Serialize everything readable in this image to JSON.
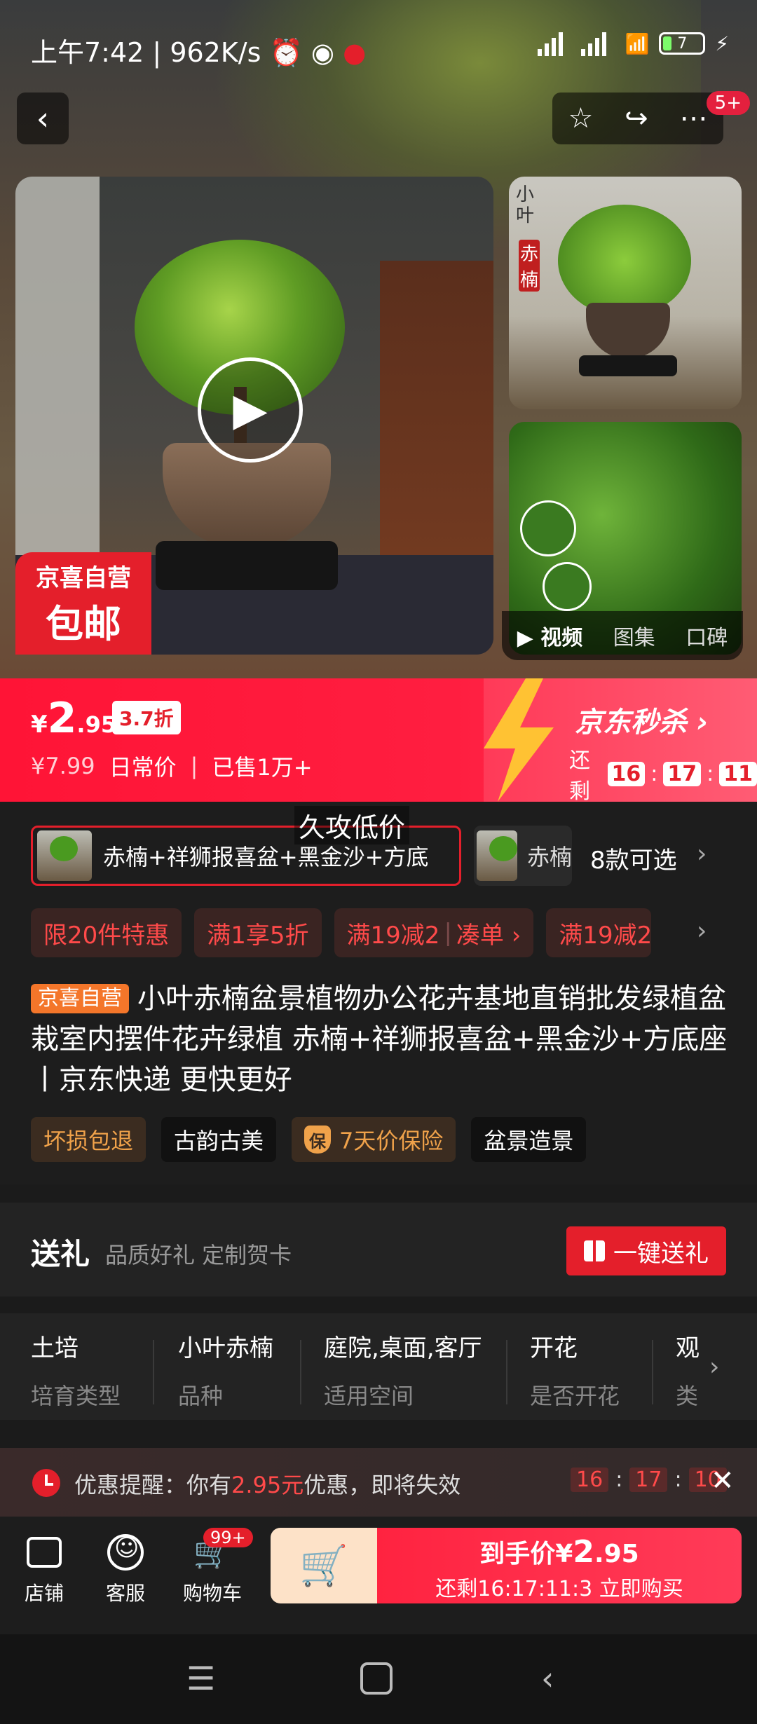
{
  "status_bar": {
    "time": "上午7:42",
    "speed": "962K/s",
    "battery": "7"
  },
  "header": {
    "notif_count": "5+"
  },
  "gallery": {
    "badge_line1": "京喜自营",
    "badge_line2": "包邮",
    "thumb_text_1": "小叶",
    "thumb_text_2": "赤楠",
    "tabs": [
      "视频",
      "图集",
      "口碑"
    ]
  },
  "price": {
    "currency": "¥",
    "int": "2",
    "dec": ".95",
    "discount": "3.7折",
    "orig": "¥7.99",
    "orig_label": "日常价",
    "sold": "已售1万+",
    "seckill_title": "京东秒杀",
    "seckill_remain": "还剩",
    "countdown": [
      "16",
      "17",
      "11"
    ]
  },
  "variants": {
    "low_price_tip": "久攻低价",
    "selected": "赤楠+祥狮报喜盆+黑金沙+方底",
    "second": "赤楠",
    "count": "8款可选"
  },
  "promos": [
    "限20件特惠",
    "满1享5折",
    "满19减2",
    "凑单 ›",
    "满19减2"
  ],
  "product": {
    "tag": "京喜自营",
    "title": "小叶赤楠盆景植物办公花卉基地直销批发绿植盆栽室内摆件花卉绿植 赤楠+祥狮报喜盆+黑金沙+方底座丨京东快递 更快更好"
  },
  "chips": {
    "c1": "坏损包退",
    "c2": "古韵古美",
    "c3_icon": "保",
    "c3": "7天价保险",
    "c4": "盆景造景"
  },
  "gift": {
    "title": "送礼",
    "sub": "品质好礼 定制贺卡",
    "button": "一键送礼"
  },
  "attributes": [
    {
      "value": "土培",
      "key": "培育类型"
    },
    {
      "value": "小叶赤楠",
      "key": "品种"
    },
    {
      "value": "庭院,桌面,客厅",
      "key": "适用空间"
    },
    {
      "value": "开花",
      "key": "是否开花"
    },
    {
      "value": "观",
      "key": "类"
    }
  ],
  "reminder": {
    "prefix": "优惠提醒：你有",
    "amount": "2.95元",
    "suffix": "优惠，即将失效",
    "timer": [
      "16",
      "17",
      "10"
    ]
  },
  "action_bar": {
    "store": "店铺",
    "service": "客服",
    "cart": "购物车",
    "cart_badge": "99+",
    "buy_line1_prefix": "到手价",
    "buy_currency": "¥",
    "buy_int": "2",
    "buy_dec": ".95",
    "buy_line2": "还剩16:17:11:3 立即购买"
  },
  "colors": {
    "accent": "#e41f2b",
    "price_banner": "#ff1436",
    "tag_orange": "#f4762a"
  }
}
